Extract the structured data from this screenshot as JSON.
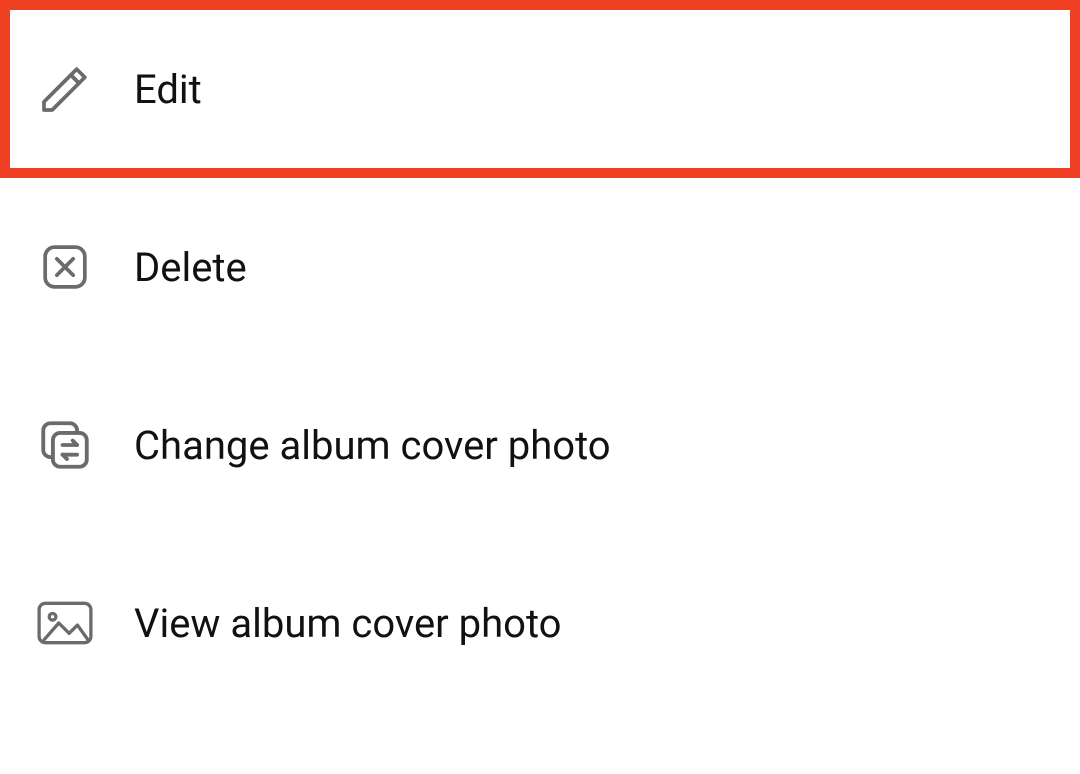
{
  "menu": {
    "items": [
      {
        "label": "Edit",
        "icon": "pencil-icon",
        "highlighted": true
      },
      {
        "label": "Delete",
        "icon": "x-box-icon",
        "highlighted": false
      },
      {
        "label": "Change album cover photo",
        "icon": "swap-cards-icon",
        "highlighted": false
      },
      {
        "label": "View album cover photo",
        "icon": "image-icon",
        "highlighted": false
      }
    ]
  },
  "colors": {
    "highlight_border": "#f04124",
    "icon_stroke": "#6b6b6b",
    "text": "#111111"
  }
}
